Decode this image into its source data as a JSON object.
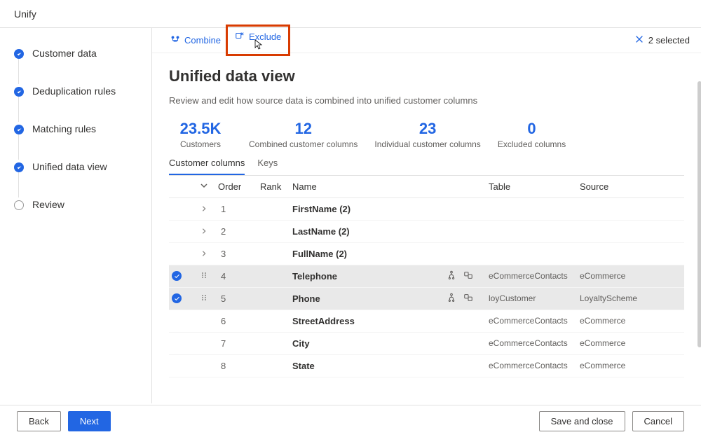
{
  "header": {
    "title": "Unify"
  },
  "sidebar": {
    "steps": [
      {
        "label": "Customer data",
        "state": "done"
      },
      {
        "label": "Deduplication rules",
        "state": "done"
      },
      {
        "label": "Matching rules",
        "state": "done"
      },
      {
        "label": "Unified data view",
        "state": "done"
      },
      {
        "label": "Review",
        "state": "open"
      }
    ]
  },
  "toolbar": {
    "combine_label": "Combine",
    "exclude_label": "Exclude",
    "selected_label": "2 selected"
  },
  "page": {
    "title": "Unified data view",
    "subtitle": "Review and edit how source data is combined into unified customer columns"
  },
  "summary": [
    {
      "value": "23.5K",
      "label": "Customers"
    },
    {
      "value": "12",
      "label": "Combined customer columns"
    },
    {
      "value": "23",
      "label": "Individual customer columns"
    },
    {
      "value": "0",
      "label": "Excluded columns"
    }
  ],
  "tabs": {
    "customer_columns": "Customer columns",
    "keys": "Keys",
    "active": 0
  },
  "table": {
    "headers": {
      "order": "Order",
      "rank": "Rank",
      "name": "Name",
      "table": "Table",
      "source": "Source"
    },
    "rows": [
      {
        "expandable": true,
        "selected": false,
        "order": "1",
        "rank": "",
        "name": "FirstName (2)",
        "table": "",
        "source": "",
        "icons": false
      },
      {
        "expandable": true,
        "selected": false,
        "order": "2",
        "rank": "",
        "name": "LastName (2)",
        "table": "",
        "source": "",
        "icons": false
      },
      {
        "expandable": true,
        "selected": false,
        "order": "3",
        "rank": "",
        "name": "FullName (2)",
        "table": "",
        "source": "",
        "icons": false
      },
      {
        "expandable": false,
        "selected": true,
        "order": "4",
        "rank": "",
        "name": "Telephone",
        "table": "eCommerceContacts",
        "source": "eCommerce",
        "icons": true
      },
      {
        "expandable": false,
        "selected": true,
        "order": "5",
        "rank": "",
        "name": "Phone",
        "table": "loyCustomer",
        "source": "LoyaltyScheme",
        "icons": true
      },
      {
        "expandable": false,
        "selected": false,
        "order": "6",
        "rank": "",
        "name": "StreetAddress",
        "table": "eCommerceContacts",
        "source": "eCommerce",
        "icons": false
      },
      {
        "expandable": false,
        "selected": false,
        "order": "7",
        "rank": "",
        "name": "City",
        "table": "eCommerceContacts",
        "source": "eCommerce",
        "icons": false
      },
      {
        "expandable": false,
        "selected": false,
        "order": "8",
        "rank": "",
        "name": "State",
        "table": "eCommerceContacts",
        "source": "eCommerce",
        "icons": false
      }
    ]
  },
  "footer": {
    "back": "Back",
    "next": "Next",
    "save_close": "Save and close",
    "cancel": "Cancel"
  }
}
